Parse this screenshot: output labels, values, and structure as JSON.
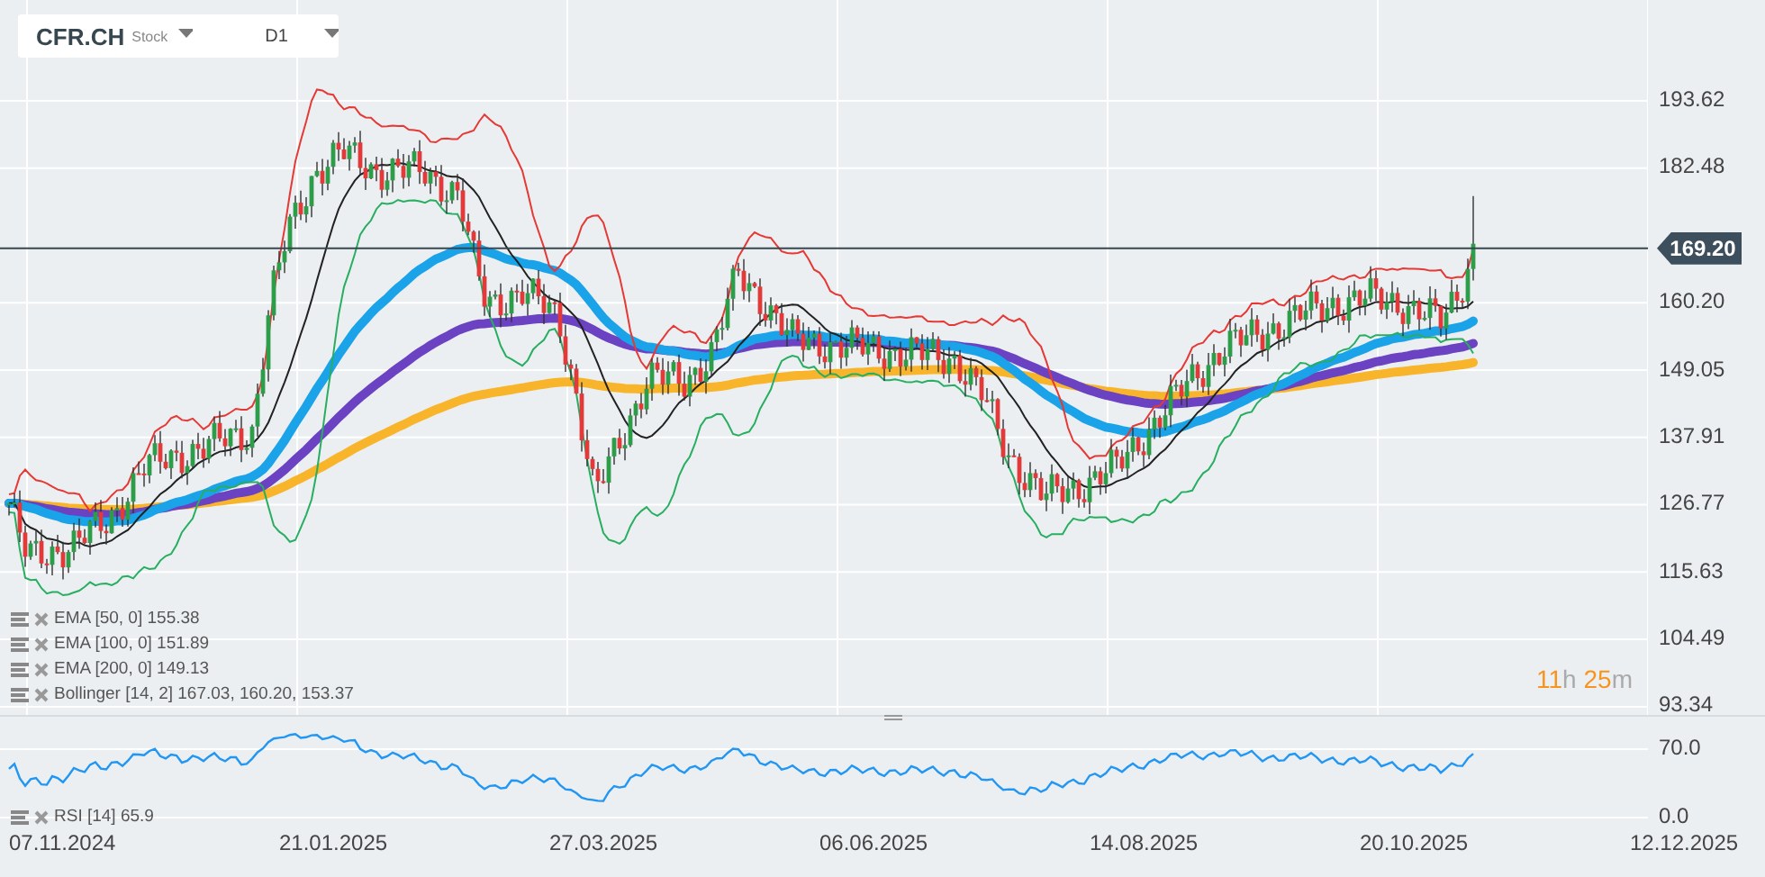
{
  "header": {
    "symbol": "CFR.CH",
    "type": "Stock",
    "timeframe": "D1"
  },
  "price_axis": [
    "193.62",
    "182.48",
    "160.20",
    "149.05",
    "137.91",
    "126.77",
    "115.63",
    "104.49",
    "93.34"
  ],
  "current_price": "169.20",
  "countdown": {
    "hours": "11",
    "hours_unit": "h",
    "minutes": "25",
    "minutes_unit": "m"
  },
  "indicators": [
    {
      "label": "EMA [50, 0] 155.38"
    },
    {
      "label": "EMA [100, 0] 151.89"
    },
    {
      "label": "EMA [200, 0] 149.13"
    },
    {
      "label": "Bollinger [14, 2] 167.03, 160.20, 153.37"
    }
  ],
  "rsi": {
    "label": "RSI [14] 65.9",
    "axis": [
      "70.0",
      "0.0"
    ]
  },
  "time_axis": [
    "07.11.2024",
    "21.01.2025",
    "27.03.2025",
    "06.06.2025",
    "14.08.2025",
    "20.10.2025",
    "12.12.2025"
  ]
}
